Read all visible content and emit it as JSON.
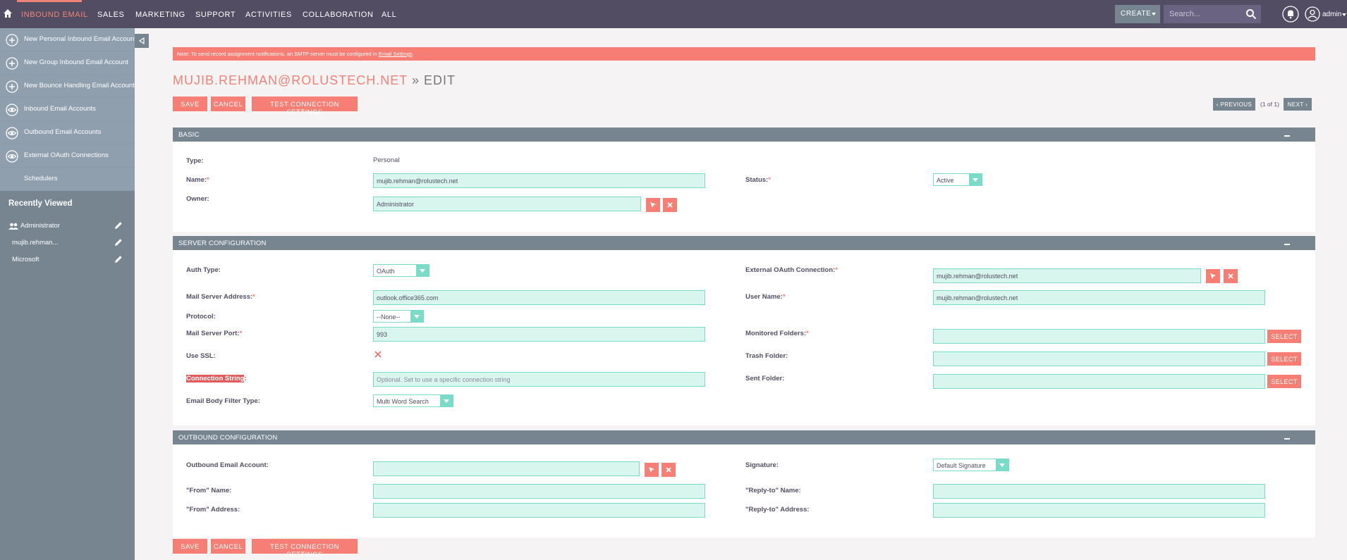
{
  "nav": {
    "tabs": [
      "INBOUND EMAIL",
      "SALES",
      "MARKETING",
      "SUPPORT",
      "ACTIVITIES",
      "COLLABORATION",
      "ALL"
    ],
    "create_label": "CREATE",
    "search_placeholder": "Search...",
    "user_label": "admin"
  },
  "sidebar": {
    "actions": [
      {
        "label": "New Personal Inbound Email Account",
        "icon": "plus-circle-icon"
      },
      {
        "label": "New Group Inbound Email Account",
        "icon": "plus-circle-icon"
      },
      {
        "label": "New Bounce Handling Email Account",
        "icon": "plus-circle-icon"
      },
      {
        "label": "Inbound Email Accounts",
        "icon": "eye-icon"
      },
      {
        "label": "Outbound Email Accounts",
        "icon": "eye-icon"
      },
      {
        "label": "External OAuth Connections",
        "icon": "eye-icon"
      },
      {
        "label": "Schedulers",
        "icon": ""
      }
    ],
    "recently_viewed_title": "Recently Viewed",
    "recently_viewed": [
      "Administrator",
      "mujib.rehman...",
      "Microsoft"
    ]
  },
  "notice": {
    "text": "Note: To send record assignment notifications, an SMTP server must be configured in ",
    "link": "Email Settings",
    "end": "."
  },
  "title": {
    "record": "MUJIB.REHMAN@ROLUSTECH.NET",
    "sep": " » ",
    "action": "EDIT"
  },
  "buttons": {
    "save": "SAVE",
    "cancel": "CANCEL",
    "test": "TEST CONNECTION SETTINGS",
    "select": "SELECT"
  },
  "pager": {
    "previous": "PREVIOUS",
    "count": "(1 of 1)",
    "next": "NEXT"
  },
  "basic": {
    "header": "BASIC",
    "type_label": "Type:",
    "type_value": "Personal",
    "name_label": "Name:",
    "name_value": "mujib.rehman@rolustech.net",
    "owner_label": "Owner:",
    "owner_value": "Administrator",
    "status_label": "Status:",
    "status_value": "Active"
  },
  "server": {
    "header": "SERVER CONFIGURATION",
    "auth_label": "Auth Type:",
    "auth_value": "OAuth",
    "ext_label": "External OAuth Connection:",
    "ext_value": "mujib.rehman@rolustech.net",
    "mail_server_label": "Mail Server Address:",
    "mail_server_value": "outlook.office365.com",
    "user_label": "User Name:",
    "user_value": "mujib.rehman@rolustech.net",
    "protocol_label": "Protocol:",
    "protocol_value": "--None--",
    "port_label": "Mail Server Port:",
    "port_value": "993",
    "monitored_label": "Monitored Folders:",
    "ssl_label": "Use SSL:",
    "trash_label": "Trash Folder:",
    "conn_label": "Connection String",
    "conn_suffix": ":",
    "conn_placeholder": "Optional. Set to use a specific connection string",
    "sent_label": "Sent Folder:",
    "filter_label": "Email Body Filter Type:",
    "filter_value": "Multi Word Search"
  },
  "outbound": {
    "header": "OUTBOUND CONFIGURATION",
    "account_label": "Outbound Email Account:",
    "signature_label": "Signature:",
    "signature_value": "Default Signature",
    "from_name_label": "\"From\" Name:",
    "reply_name_label": "\"Reply-to\" Name:",
    "from_addr_label": "\"From\" Address:",
    "reply_addr_label": "\"Reply-to\" Address:"
  },
  "colors": {
    "accent": "#f67e74",
    "nav": "#534d64",
    "sidebar": "#778591",
    "input": "#d8f5ee"
  }
}
